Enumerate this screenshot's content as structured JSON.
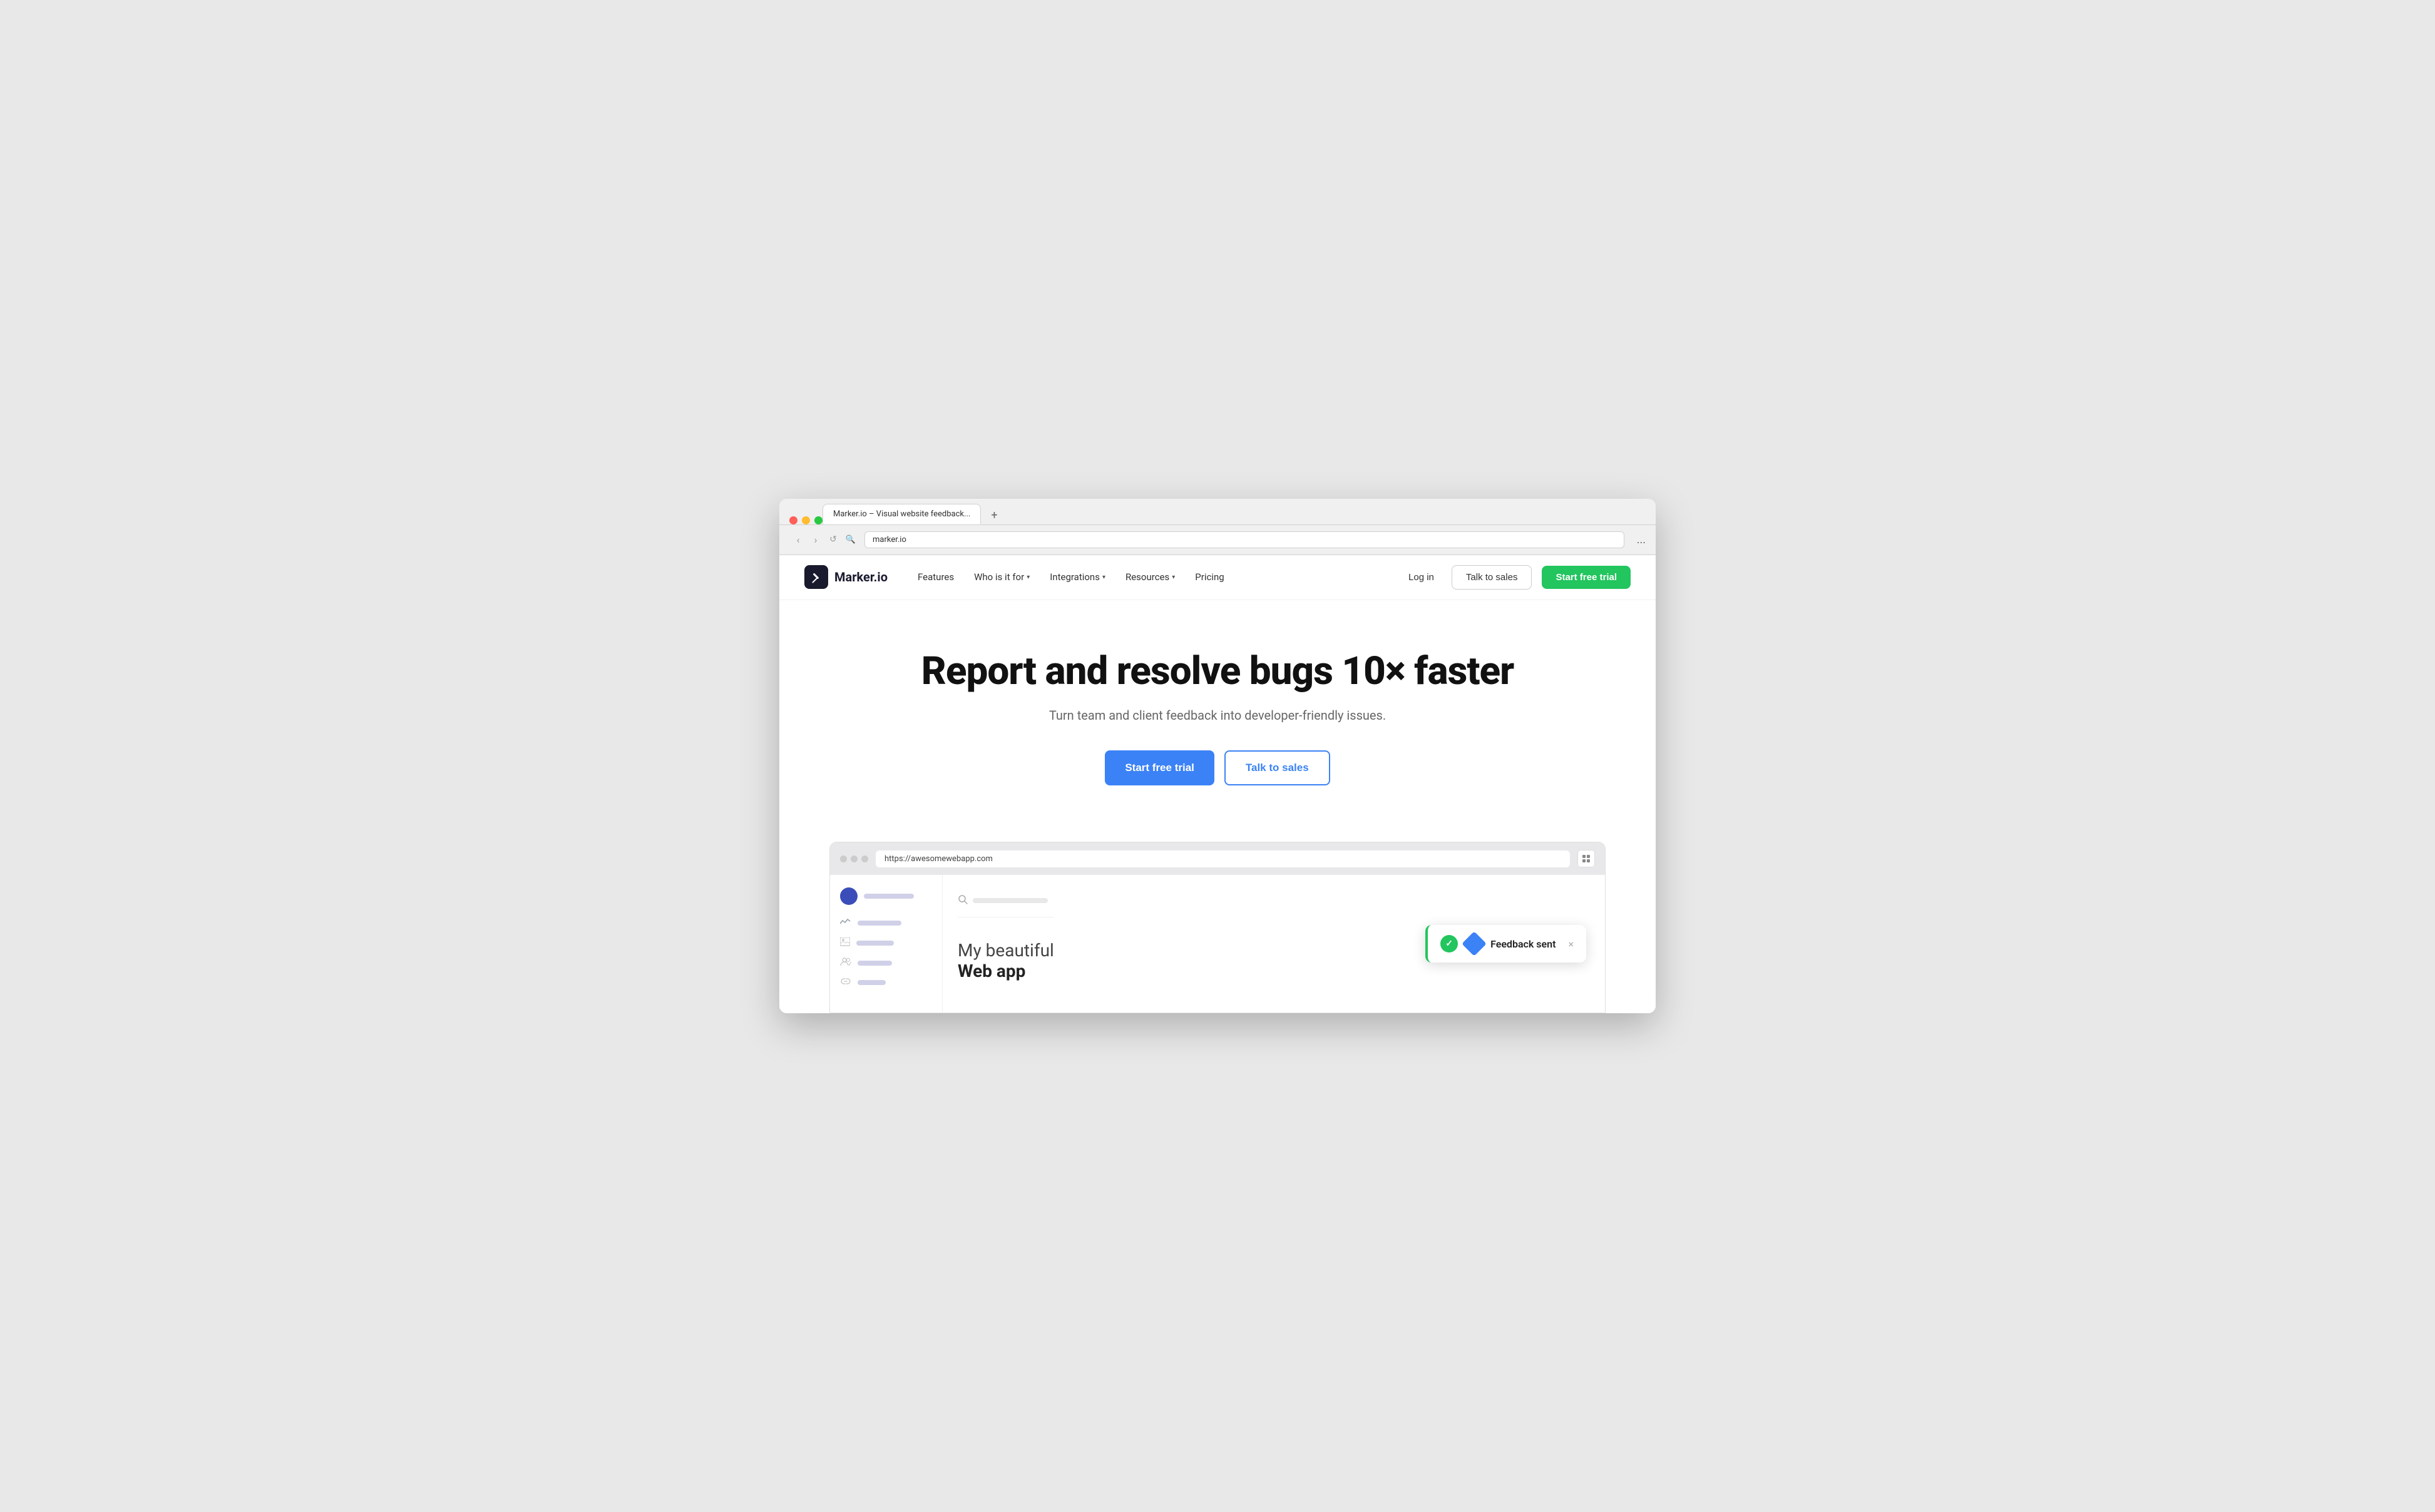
{
  "browser": {
    "dots": [
      "red",
      "yellow",
      "green"
    ],
    "back_arrow": "‹",
    "forward_arrow": "›",
    "refresh_icon": "↺",
    "search_icon": "🔍",
    "tab_label": "Marker.io – Visual website feedback...",
    "tab_plus": "+",
    "address_url": "",
    "menu_dots": "..."
  },
  "nav": {
    "logo_icon": "✏",
    "logo_text": "Marker.io",
    "links": [
      {
        "label": "Features",
        "has_dropdown": false
      },
      {
        "label": "Who is it for",
        "has_dropdown": true
      },
      {
        "label": "Integrations",
        "has_dropdown": true
      },
      {
        "label": "Resources",
        "has_dropdown": true
      },
      {
        "label": "Pricing",
        "has_dropdown": false
      }
    ],
    "login_label": "Log in",
    "talk_sales_label": "Talk to sales",
    "start_trial_label": "Start free trial"
  },
  "hero": {
    "title": "Report and resolve bugs 10× faster",
    "subtitle": "Turn team and client feedback into developer-friendly issues.",
    "cta_primary": "Start free trial",
    "cta_secondary": "Talk to sales"
  },
  "demo": {
    "address": "https://awesomewebapp.com",
    "app_title_line1": "My beautiful",
    "app_title_line2": "Web app",
    "feedback_text": "Feedback sent",
    "search_placeholder": "",
    "close_icon": "×"
  },
  "colors": {
    "green": "#22c55e",
    "blue": "#3b82f6",
    "dark": "#1a1a2e",
    "text_gray": "#666"
  }
}
